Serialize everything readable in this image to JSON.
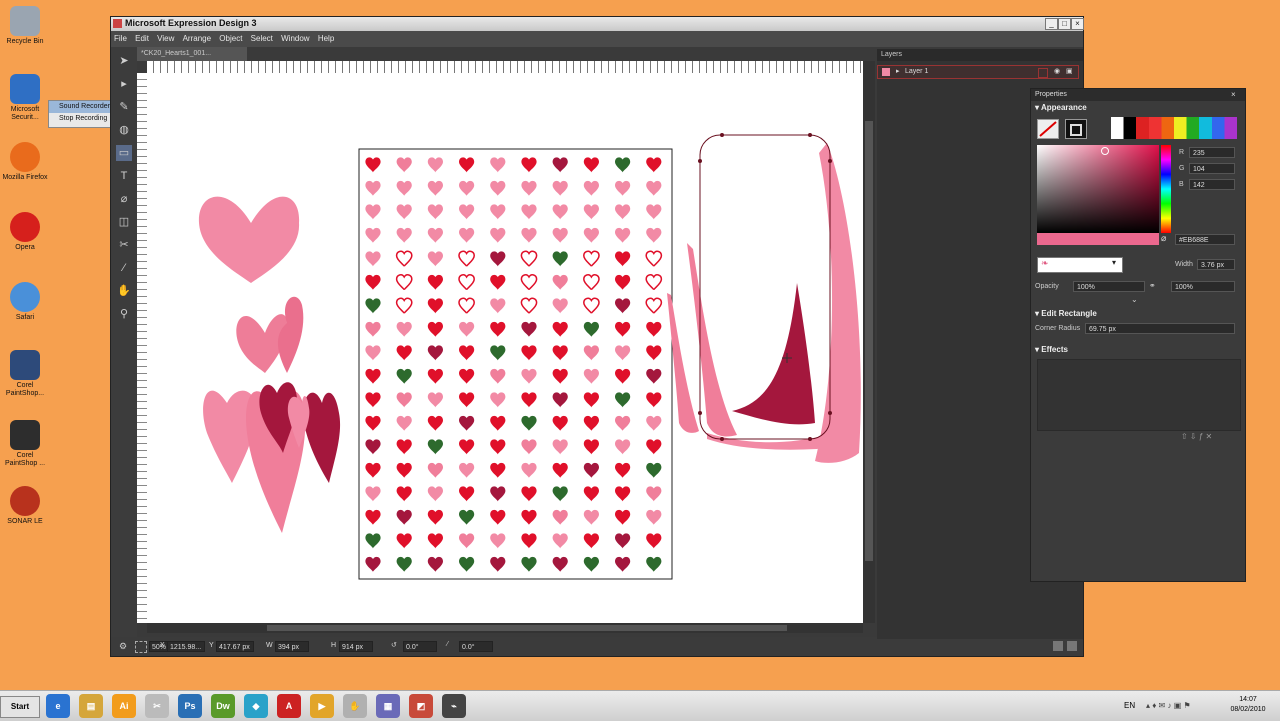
{
  "desktop": {
    "icons": [
      {
        "label": "Recycle Bin",
        "color": "#9aa5b1"
      },
      {
        "label": "Microsoft Securit...",
        "color": "#2f6fc4"
      },
      {
        "label": "Mozilla Firefox",
        "color": "#e96b1c"
      },
      {
        "label": "Opera",
        "color": "#d6201c"
      },
      {
        "label": "Safari",
        "color": "#4a90d9"
      },
      {
        "label": "Corel PaintShop...",
        "color": "#2d4a7a"
      },
      {
        "label": "Corel PaintShop ...",
        "color": "#2d2d2d"
      },
      {
        "label": "SONAR LE",
        "color": "#b8321d"
      }
    ],
    "popup": {
      "item1": "Sound Recorder",
      "item2": "Stop Recording"
    }
  },
  "window": {
    "title": "Microsoft Expression Design 3",
    "menu": [
      "File",
      "Edit",
      "View",
      "Arrange",
      "Object",
      "Select",
      "Window",
      "Help"
    ],
    "doc_tab": "*CK20_Hearts1_001...",
    "zoom": "50%",
    "status": {
      "x_label": "X",
      "x": "1215.98...",
      "y_label": "Y",
      "y": "417.67 px",
      "w_label": "W",
      "w": "394 px",
      "h_label": "H",
      "h": "914 px",
      "rot": "0.0°",
      "skew": "0.0°"
    }
  },
  "layers": {
    "title": "Layers",
    "layer1": "Layer 1"
  },
  "properties": {
    "title": "Properties",
    "appearance": "Appearance",
    "r": "235",
    "g": "104",
    "b": "142",
    "hex": "#EB688E",
    "width_label": "Width",
    "width": "3.76 px",
    "opacity_label": "Opacity",
    "opacity": "100%",
    "opacity2": "100%",
    "edit_rect": "Edit Rectangle",
    "corner_label": "Corner Radius",
    "corner": "69.75 px",
    "effects": "Effects"
  },
  "taskbar": {
    "start": "Start",
    "lang": "EN",
    "time": "14:07",
    "date": "08/02/2010",
    "apps": [
      {
        "label": "e",
        "color": "#2a73d1"
      },
      {
        "label": "▤",
        "color": "#d5a63b"
      },
      {
        "label": "Ai",
        "color": "#f29c1c"
      },
      {
        "label": "✂",
        "color": "#bbbbbb"
      },
      {
        "label": "Ps",
        "color": "#2a6fb5"
      },
      {
        "label": "Dw",
        "color": "#5a9a2a"
      },
      {
        "label": "◆",
        "color": "#2aa2c9"
      },
      {
        "label": "A",
        "color": "#cc2222"
      },
      {
        "label": "▶",
        "color": "#e2a52a"
      },
      {
        "label": "✋",
        "color": "#b0b0b0"
      },
      {
        "label": "▦",
        "color": "#6a6ab8"
      },
      {
        "label": "◩",
        "color": "#c84a3a"
      },
      {
        "label": "⌁",
        "color": "#444444"
      }
    ]
  },
  "colors": {
    "heart_pink": "#f28aa5",
    "heart_dark": "#a4173d",
    "heart_red": "#e0102a"
  }
}
